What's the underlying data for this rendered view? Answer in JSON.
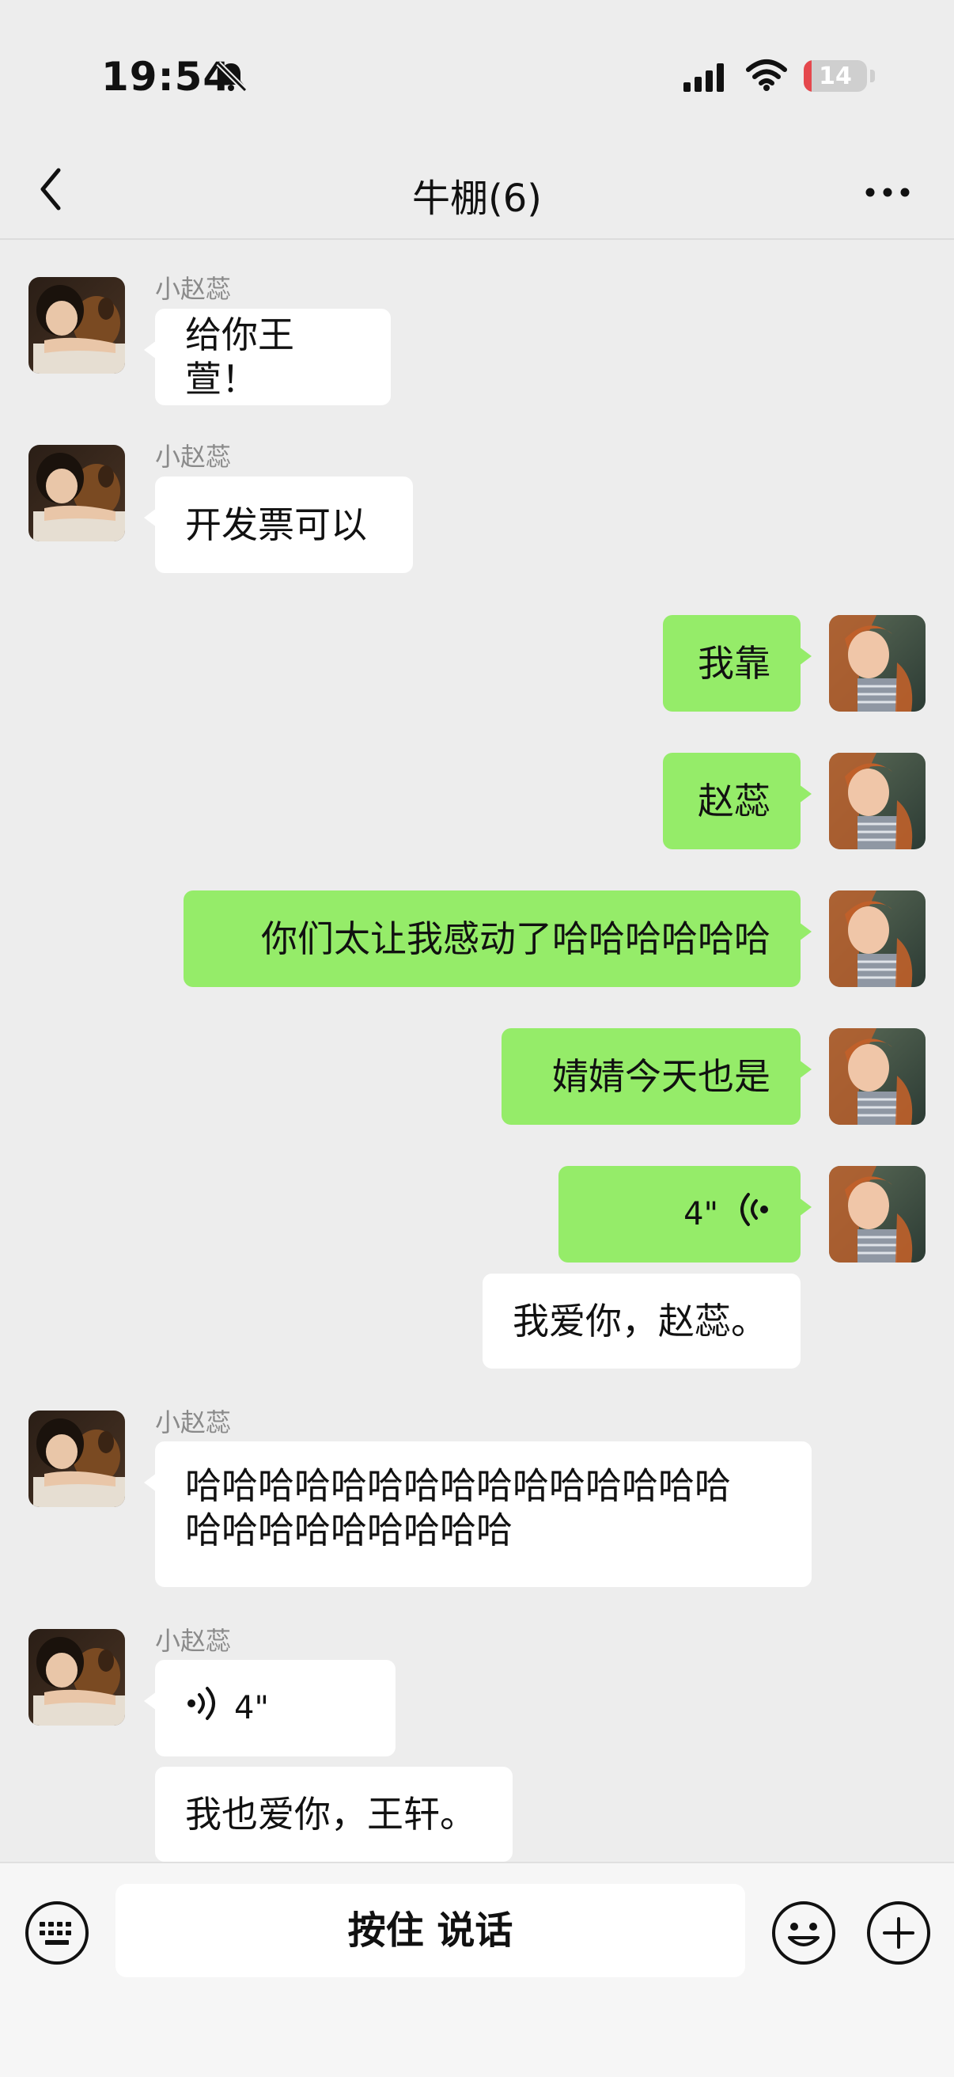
{
  "status_bar": {
    "time": "19:54",
    "battery": "14"
  },
  "nav": {
    "title": "牛棚(6)"
  },
  "messages": {
    "m1": {
      "sender": "小赵蕊",
      "text": "给你王萱！"
    },
    "m2": {
      "sender": "小赵蕊",
      "text": "开发票可以"
    },
    "m3": {
      "text": "我靠"
    },
    "m4": {
      "text": "赵蕊"
    },
    "m5": {
      "text": "你们太让我感动了哈哈哈哈哈哈"
    },
    "m6": {
      "text": "婧婧今天也是"
    },
    "m7": {
      "duration": "4\"",
      "transcript": "我爱你，赵蕊。"
    },
    "m8": {
      "sender": "小赵蕊",
      "line1": "哈哈哈哈哈哈哈哈哈哈哈哈哈哈哈",
      "line2": "哈哈哈哈哈哈哈哈哈"
    },
    "m9": {
      "sender": "小赵蕊",
      "duration": "4\"",
      "transcript": "我也爱你，王轩。"
    }
  },
  "input_bar": {
    "hold_to_talk": "按住 说话"
  },
  "icons": [
    "bell-slash-icon",
    "signal-icon",
    "wifi-icon",
    "back-icon",
    "more-icon",
    "voice-wave-icon",
    "keyboard-icon",
    "emoji-icon",
    "plus-icon"
  ],
  "colors": {
    "background": "#EDEDED",
    "outgoing_bubble": "#95EC69",
    "incoming_bubble": "#FFFFFF",
    "battery_low": "#E5484D"
  }
}
